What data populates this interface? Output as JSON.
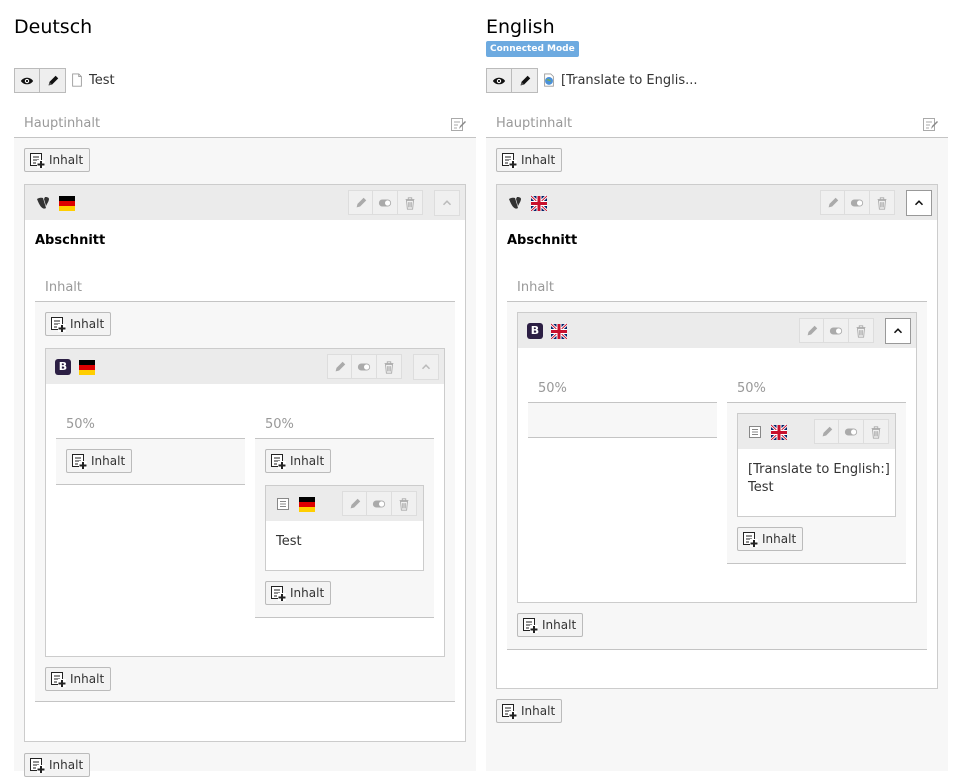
{
  "left": {
    "language": "Deutsch",
    "page_title": "Test",
    "column_label": "Hauptinhalt",
    "add_label": "Inhalt",
    "section_title": "Abschnitt",
    "inner_column_label": "Inhalt",
    "grid_col1": "50%",
    "grid_col2": "50%",
    "text_content": "Test"
  },
  "right": {
    "language": "English",
    "badge": "Connected Mode",
    "page_title": "[Translate to Englis...",
    "column_label": "Hauptinhalt",
    "add_label": "Inhalt",
    "section_title": "Abschnitt",
    "inner_column_label": "Inhalt",
    "grid_col1": "50%",
    "grid_col2": "50%",
    "text_line1": "[Translate to English:]",
    "text_line2": "Test"
  },
  "icons": [
    "eye-icon",
    "pencil-icon",
    "page-icon",
    "globe-page-icon",
    "column-edit-icon",
    "add-content-icon",
    "typo3-icon",
    "flag-de-icon",
    "flag-uk-icon",
    "bootstrap-icon",
    "text-element-icon",
    "edit-icon",
    "toggle-icon",
    "trash-icon",
    "chevron-up-icon"
  ],
  "colors": {
    "badge": "#6daae0",
    "header_bg": "#ebebeb",
    "area_bg": "#f7f7f7"
  }
}
